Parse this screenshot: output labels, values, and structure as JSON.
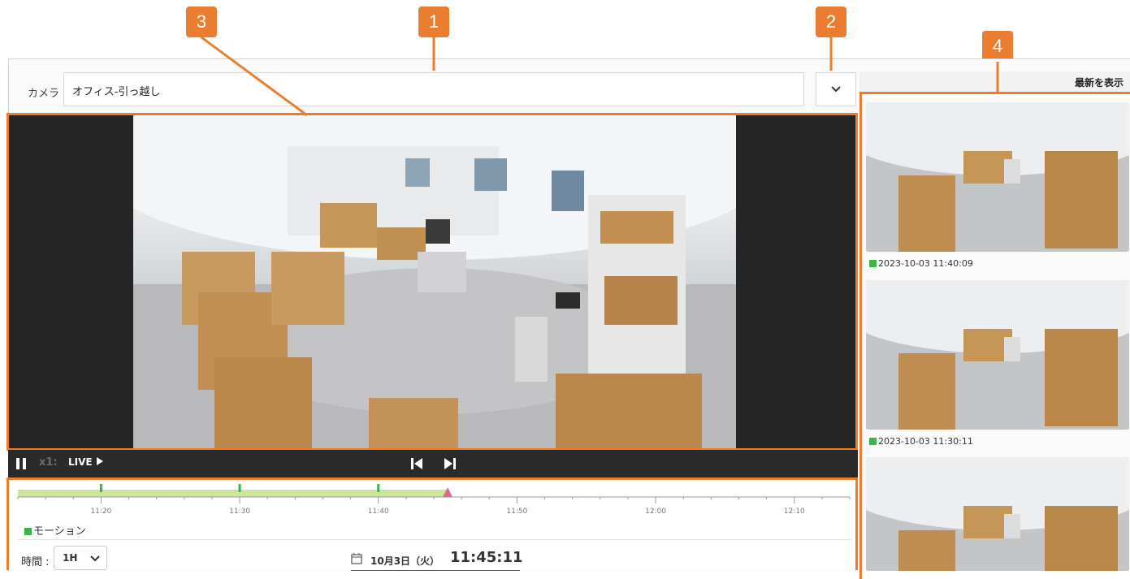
{
  "callouts": [
    "1",
    "2",
    "3",
    "4"
  ],
  "camera": {
    "label": "カメラ",
    "value": "オフィス-引っ越し"
  },
  "player": {
    "speed": "x1:",
    "live": "LIVE"
  },
  "timeline": {
    "ticks": [
      "11:20",
      "11:30",
      "11:40",
      "11:50",
      "12:00",
      "12:10"
    ],
    "legend": "モーション",
    "interval_label": "時間 :",
    "interval_value": "1H",
    "date": "10月3日（火）",
    "time": "11:45:11",
    "motion_color": "#3cb44a",
    "recorded_color": "#cbe69b",
    "cursor_color": "#e06a8c"
  },
  "sidebar": {
    "show_latest": "最新を表示",
    "snapshots": [
      {
        "timestamp": "2023-10-03 11:40:09"
      },
      {
        "timestamp": "2023-10-03 11:30:11"
      },
      {
        "timestamp": ""
      }
    ]
  },
  "accent": "#ea7d2f"
}
